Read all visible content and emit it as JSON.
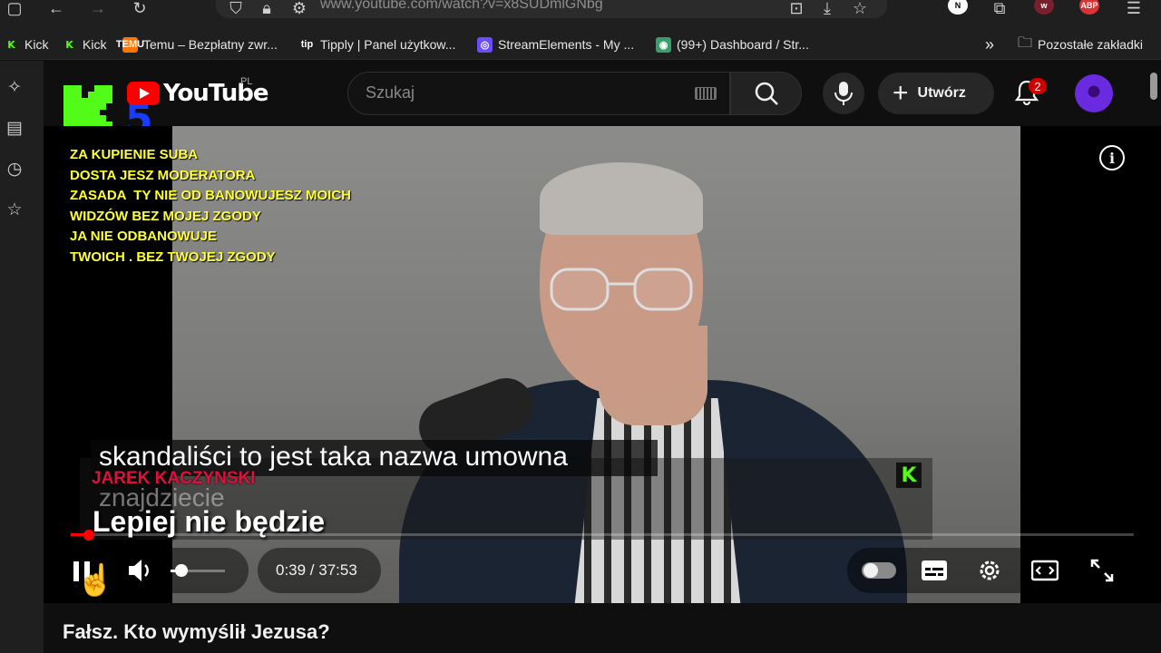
{
  "browser": {
    "url": "www.youtube.com/watch?v=x8SUDmlGNbg",
    "ext_n": "N",
    "ext_abp": "ABP"
  },
  "bookmarks": [
    {
      "label": "Kick",
      "icon": "kick-icon",
      "fav": "K"
    },
    {
      "label": "Kick",
      "icon": "kick-icon",
      "fav": "K"
    },
    {
      "label": "Temu – Bezpłatny zwr...",
      "icon": "temu-icon",
      "fav": "TEMU"
    },
    {
      "label": "Tipply | Panel użytkow...",
      "icon": "tipply-icon",
      "fav": "tip"
    },
    {
      "label": "StreamElements - My ...",
      "icon": "streamelements-icon",
      "fav": "◎"
    },
    {
      "label": "(99+) Dashboard / Str...",
      "icon": "discord-icon",
      "fav": "◉"
    }
  ],
  "bookmarks_other": "Pozostałe zakładki",
  "youtube": {
    "logo_text": "YouTube",
    "country": "PL",
    "search_placeholder": "Szukaj",
    "create_label": "Utwórz",
    "notification_count": "2"
  },
  "overlay": {
    "kick_channel_number": "5",
    "moderator_text": "ZA KUPIENIE SUBA\nDOSTA JESZ MODERATORA\nZASADA  TY NIE OD BANOWUJESZ MOICH\nWIDZÓW BEZ MOJEJ ZGODY\nJA NIE ODBANOWUJE\nTWOICH . BEZ TWOJEJ ZGODY",
    "caption_line1": "skandaliści to jest taka nazwa umowna",
    "caption_ghost": "znajdziecie",
    "name_tag": "JAREK KACZYNSKI",
    "caption_line2": "Lepiej nie będzie",
    "kick_mini": "K"
  },
  "player": {
    "time_current": "0:39",
    "time_total": "37:53",
    "time_display": "0:39 / 37:53",
    "progress_fraction": 0.017,
    "volume_fraction": 0.2,
    "state": "playing"
  },
  "video_title": "Fałsz. Kto wymyślił Jezusa?",
  "colors": {
    "youtube_red": "#ff0000",
    "kick_green": "#53fc18",
    "overlay_yellow": "#ffff33",
    "name_tag_red": "#e0103c"
  }
}
